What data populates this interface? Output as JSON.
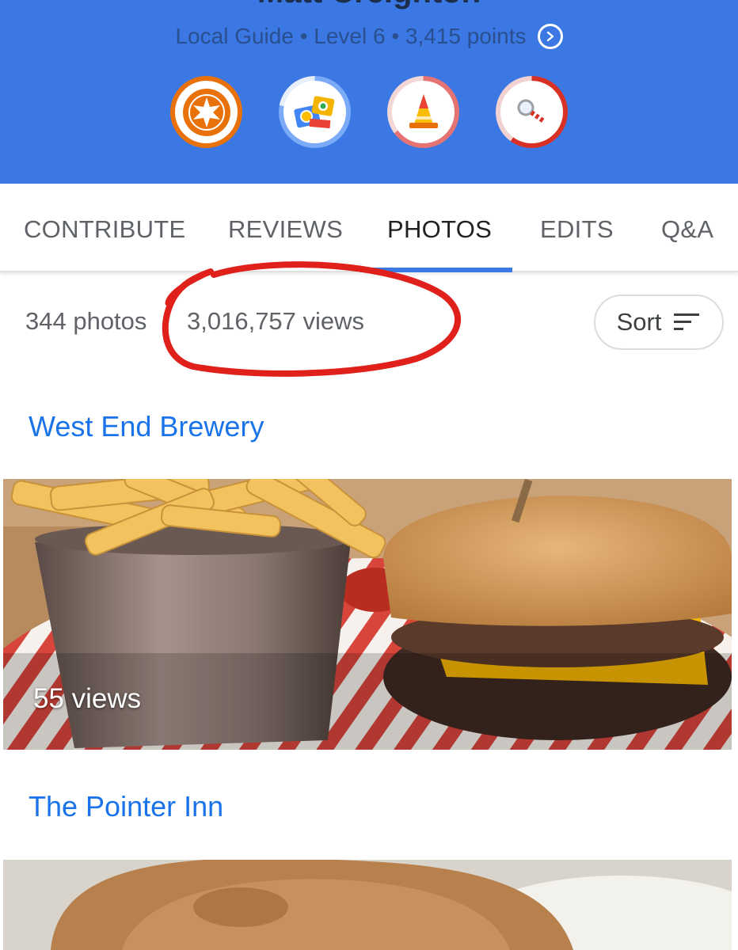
{
  "profile": {
    "name": "Matt Creighton",
    "guide_line": "Local Guide • Level 6 • 3,415 points"
  },
  "badges": [
    {
      "icon": "star-badge-icon",
      "ring_color": "#e8710a"
    },
    {
      "icon": "camera-badge-icon",
      "ring_color": "#7baaf7"
    },
    {
      "icon": "cone-badge-icon",
      "ring_color": "#e57373"
    },
    {
      "icon": "magnifier-badge-icon",
      "ring_color": "#d93025"
    }
  ],
  "tabs": [
    {
      "label": "CONTRIBUTE"
    },
    {
      "label": "REVIEWS"
    },
    {
      "label": "PHOTOS",
      "active": true
    },
    {
      "label": "EDITS"
    },
    {
      "label": "Q&A"
    }
  ],
  "summary": {
    "photos": "344 photos",
    "views": "3,016,757 views",
    "sort_label": "Sort"
  },
  "places": [
    {
      "name": "West End Brewery",
      "photo_views": "55 views"
    },
    {
      "name": "The Pointer Inn"
    }
  ],
  "colors": {
    "header": "#3b78e3",
    "accent": "#1a73e8",
    "annotation": "#e0201a"
  }
}
